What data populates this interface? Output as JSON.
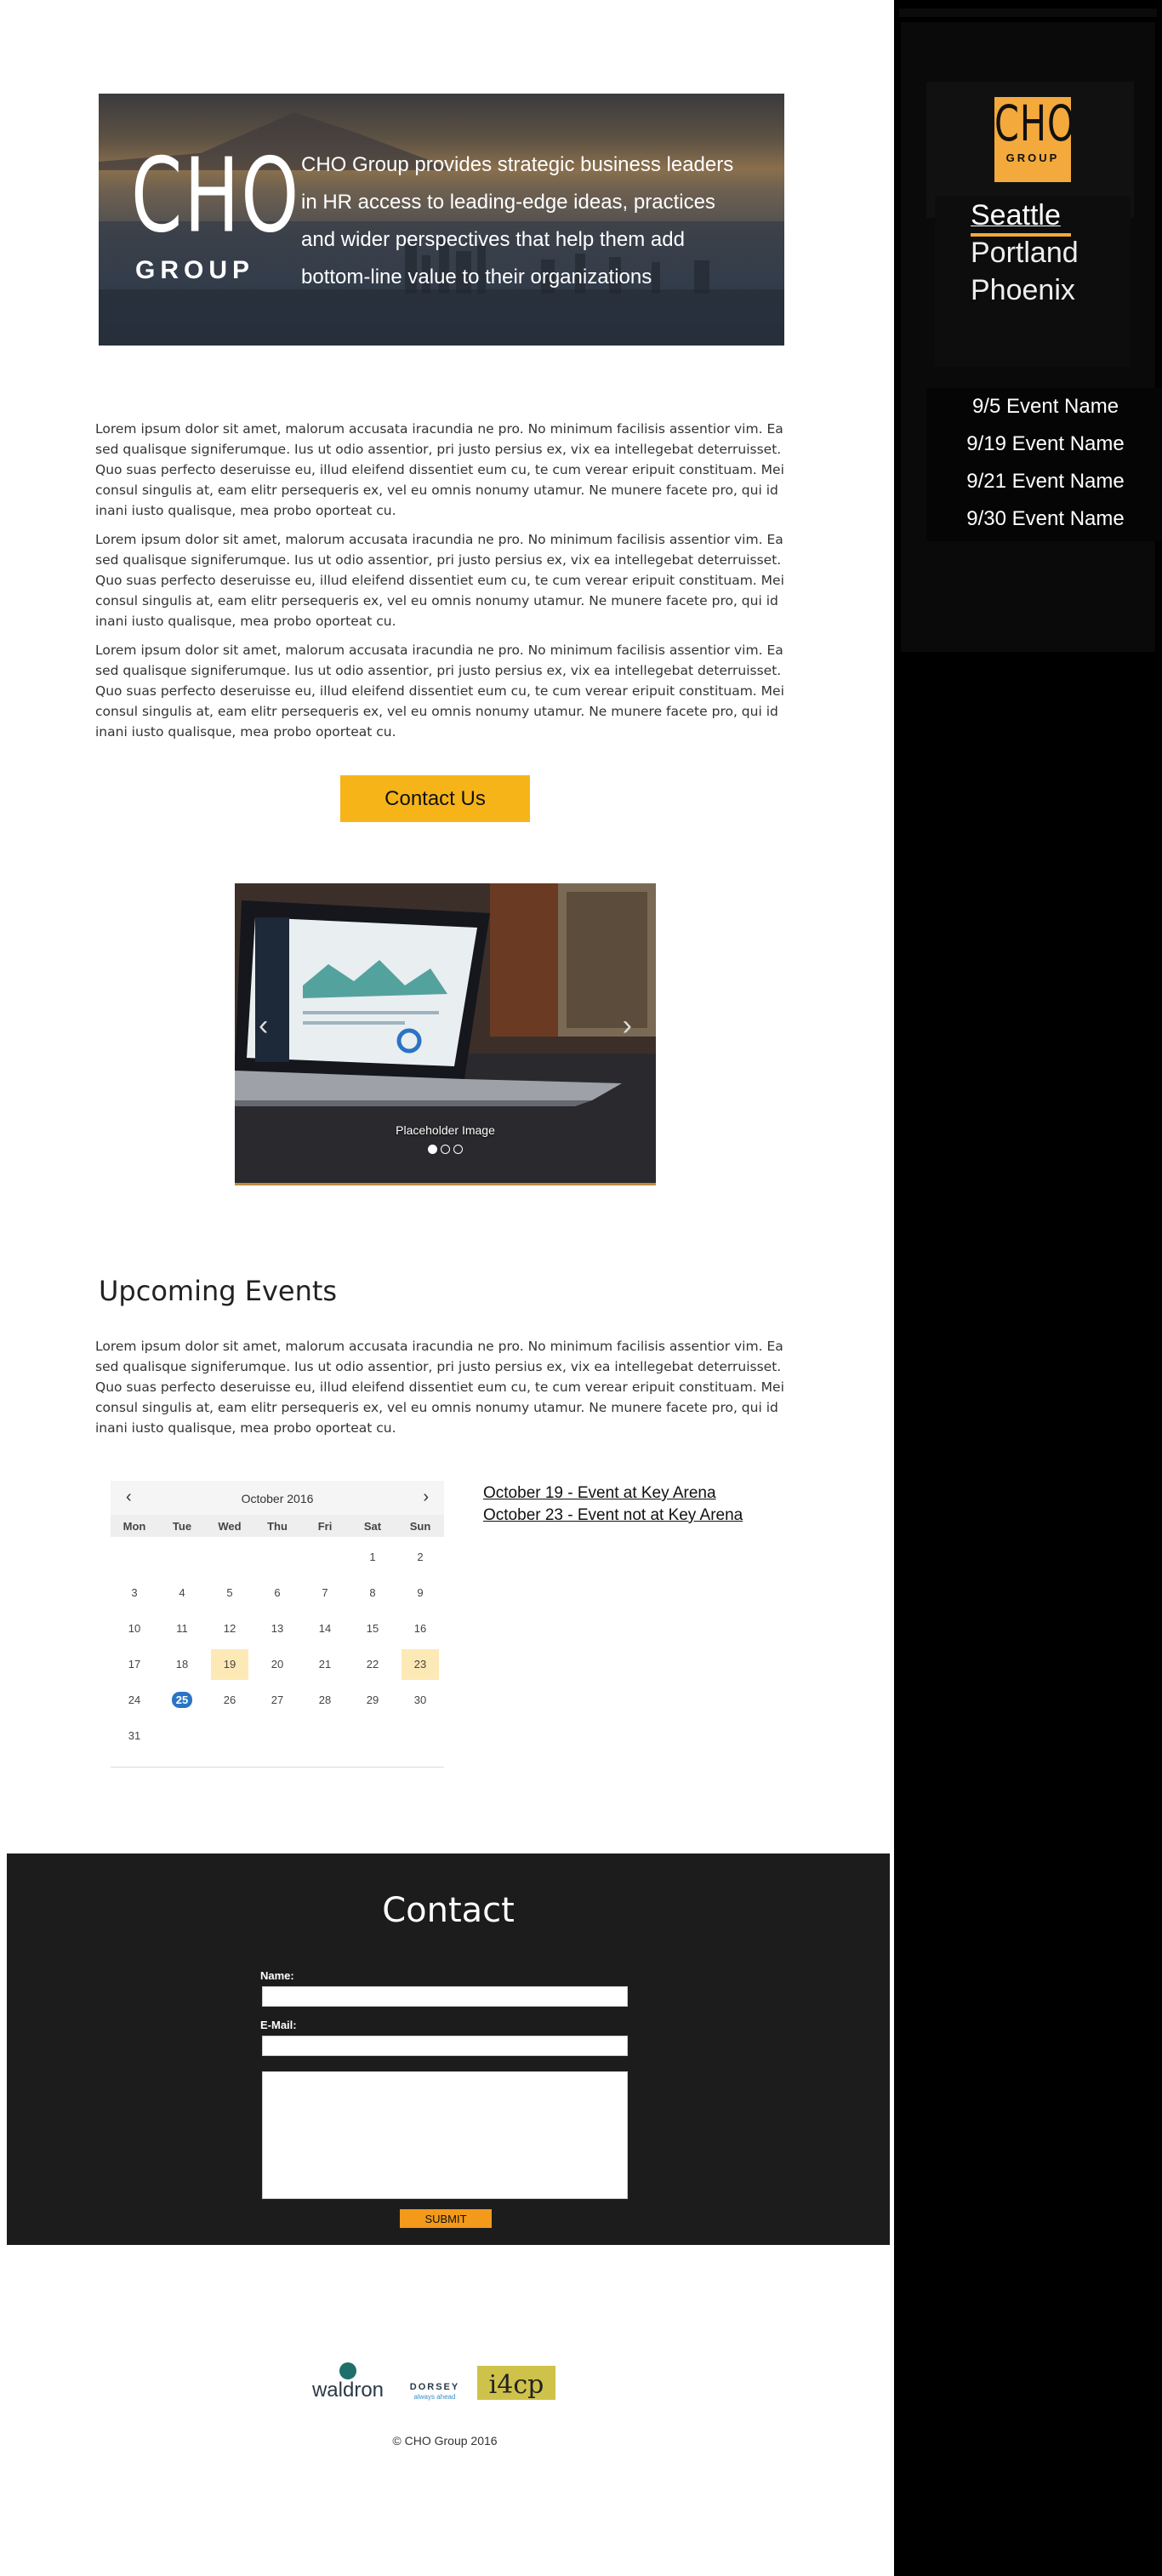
{
  "hero": {
    "logo_top": "CHO",
    "logo_bottom": "GROUP",
    "tagline": "CHO Group provides strategic business leaders in HR access to leading-edge ideas, practices and wider perspectives that help them add bottom-line value to their organizations"
  },
  "intro": {
    "paragraphs": [
      "Lorem ipsum dolor sit amet, malorum accusata iracundia ne pro. No minimum facilisis assentior vim. Ea sed qualisque signiferumque. Ius ut odio assentior, pri justo persius ex, vix ea intellegebat deterruisset. Quo suas perfecto deseruisse eu, illud eleifend dissentiet eum cu, te cum verear eripuit constituam. Mei consul singulis at, eam elitr persequeris ex, vel eu omnis nonumy utamur. Ne munere facete pro, qui id inani iusto qualisque, mea probo oporteat cu.",
      "Lorem ipsum dolor sit amet, malorum accusata iracundia ne pro. No minimum facilisis assentior vim. Ea sed qualisque signiferumque. Ius ut odio assentior, pri justo persius ex, vix ea intellegebat deterruisset. Quo suas perfecto deseruisse eu, illud eleifend dissentiet eum cu, te cum verear eripuit constituam. Mei consul singulis at, eam elitr persequeris ex, vel eu omnis nonumy utamur. Ne munere facete pro, qui id inani iusto qualisque, mea probo oporteat cu.",
      "Lorem ipsum dolor sit amet, malorum accusata iracundia ne pro. No minimum facilisis assentior vim. Ea sed qualisque signiferumque. Ius ut odio assentior, pri justo persius ex, vix ea intellegebat deterruisset. Quo suas perfecto deseruisse eu, illud eleifend dissentiet eum cu, te cum verear eripuit constituam. Mei consul singulis at, eam elitr persequeris ex, vel eu omnis nonumy utamur. Ne munere facete pro, qui id inani iusto qualisque, mea probo oporteat cu."
    ],
    "contact_button": "Contact Us"
  },
  "carousel": {
    "caption": "Placeholder Image",
    "prev_icon": "chevron-left-icon",
    "next_icon": "chevron-right-icon",
    "slide_count": 3,
    "active_slide": 1
  },
  "events_section": {
    "title": "Upcoming Events",
    "body": "Lorem ipsum dolor sit amet, malorum accusata iracundia ne pro. No minimum facilisis assentior vim. Ea sed qualisque signiferumque. Ius ut odio assentior, pri justo persius ex, vix ea intellegebat deterruisset. Quo suas perfecto deseruisse eu, illud eleifend dissentiet eum cu, te cum verear eripuit constituam. Mei consul singulis at, eam elitr persequeris ex, vel eu omnis nonumy utamur. Ne munere facete pro, qui id inani iusto qualisque, mea probo oporteat cu.",
    "links": [
      "October 19 - Event at Key Arena",
      "October 23 - Event not at Key Arena"
    ]
  },
  "calendar": {
    "month_label": "October 2016",
    "weekdays": [
      "Mon",
      "Tue",
      "Wed",
      "Thu",
      "Fri",
      "Sat",
      "Sun"
    ],
    "first_weekday_index": 5,
    "days_in_month": 31,
    "highlighted": [
      19,
      23
    ],
    "today": 25,
    "highlight_color": "#fde9b5",
    "today_color": "#2a74c6"
  },
  "contact": {
    "title": "Contact",
    "name_label": "Name:",
    "email_label": "E-Mail:",
    "submit_label": "SUBMIT"
  },
  "footer": {
    "partners": [
      "waldron",
      "DORSEY",
      "always ahead",
      "i4cp"
    ],
    "copyright": "© CHO Group 2016"
  },
  "sidebar": {
    "logo_top": "CHO",
    "logo_bottom": "GROUP",
    "cities": [
      "Seattle",
      "Portland",
      "Phoenix"
    ],
    "active_city": "Seattle",
    "events": [
      "9/5 Event Name",
      "9/19 Event Name",
      "9/21 Event Name",
      "9/30 Event Name"
    ],
    "accent": "#f3a93b"
  },
  "colors": {
    "brand_orange": "#f3a93b",
    "button_yellow": "#f6b419",
    "submit_orange": "#f39a1a",
    "contact_bg": "#1c1c1c",
    "sidebar_bg": "#000000"
  }
}
